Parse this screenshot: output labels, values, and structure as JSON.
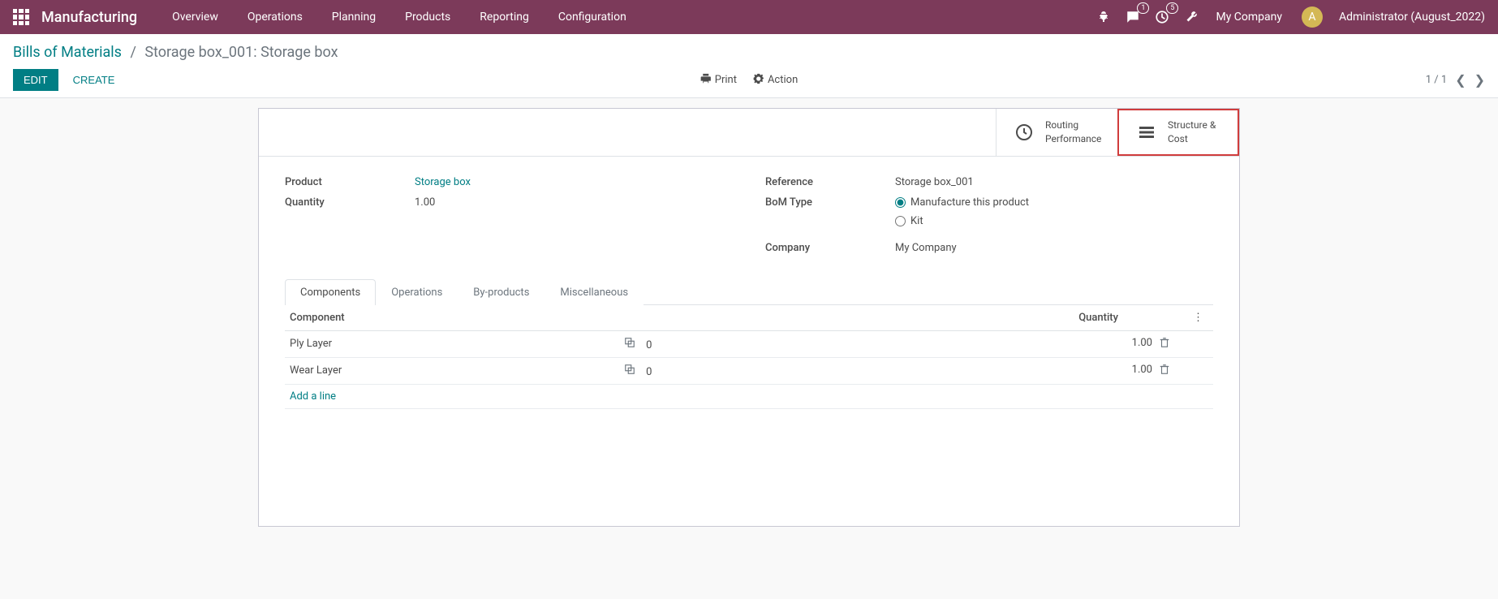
{
  "topbar": {
    "app_title": "Manufacturing",
    "nav": [
      "Overview",
      "Operations",
      "Planning",
      "Products",
      "Reporting",
      "Configuration"
    ],
    "chat_badge": "1",
    "activity_badge": "5",
    "company": "My Company",
    "avatar_initial": "A",
    "user": "Administrator (August_2022)"
  },
  "breadcrumb": {
    "root": "Bills of Materials",
    "separator": "/",
    "current": "Storage box_001: Storage box"
  },
  "buttons": {
    "edit": "EDIT",
    "create": "CREATE",
    "print": "Print",
    "action": "Action"
  },
  "pager": {
    "text": "1 / 1"
  },
  "stat_buttons": {
    "routing": "Routing\nPerformance",
    "structure": "Structure &\nCost"
  },
  "fields": {
    "product_label": "Product",
    "product_value": "Storage box",
    "quantity_label": "Quantity",
    "quantity_value": "1.00",
    "reference_label": "Reference",
    "reference_value": "Storage box_001",
    "bom_type_label": "BoM Type",
    "bom_type_opt1": "Manufacture this product",
    "bom_type_opt2": "Kit",
    "company_label": "Company",
    "company_value": "My Company"
  },
  "tabs": [
    "Components",
    "Operations",
    "By-products",
    "Miscellaneous"
  ],
  "table": {
    "head_component": "Component",
    "head_quantity": "Quantity",
    "rows": [
      {
        "name": "Ply Layer",
        "forecast": "0",
        "qty": "1.00"
      },
      {
        "name": "Wear Layer",
        "forecast": "0",
        "qty": "1.00"
      }
    ],
    "add_line": "Add a line"
  }
}
